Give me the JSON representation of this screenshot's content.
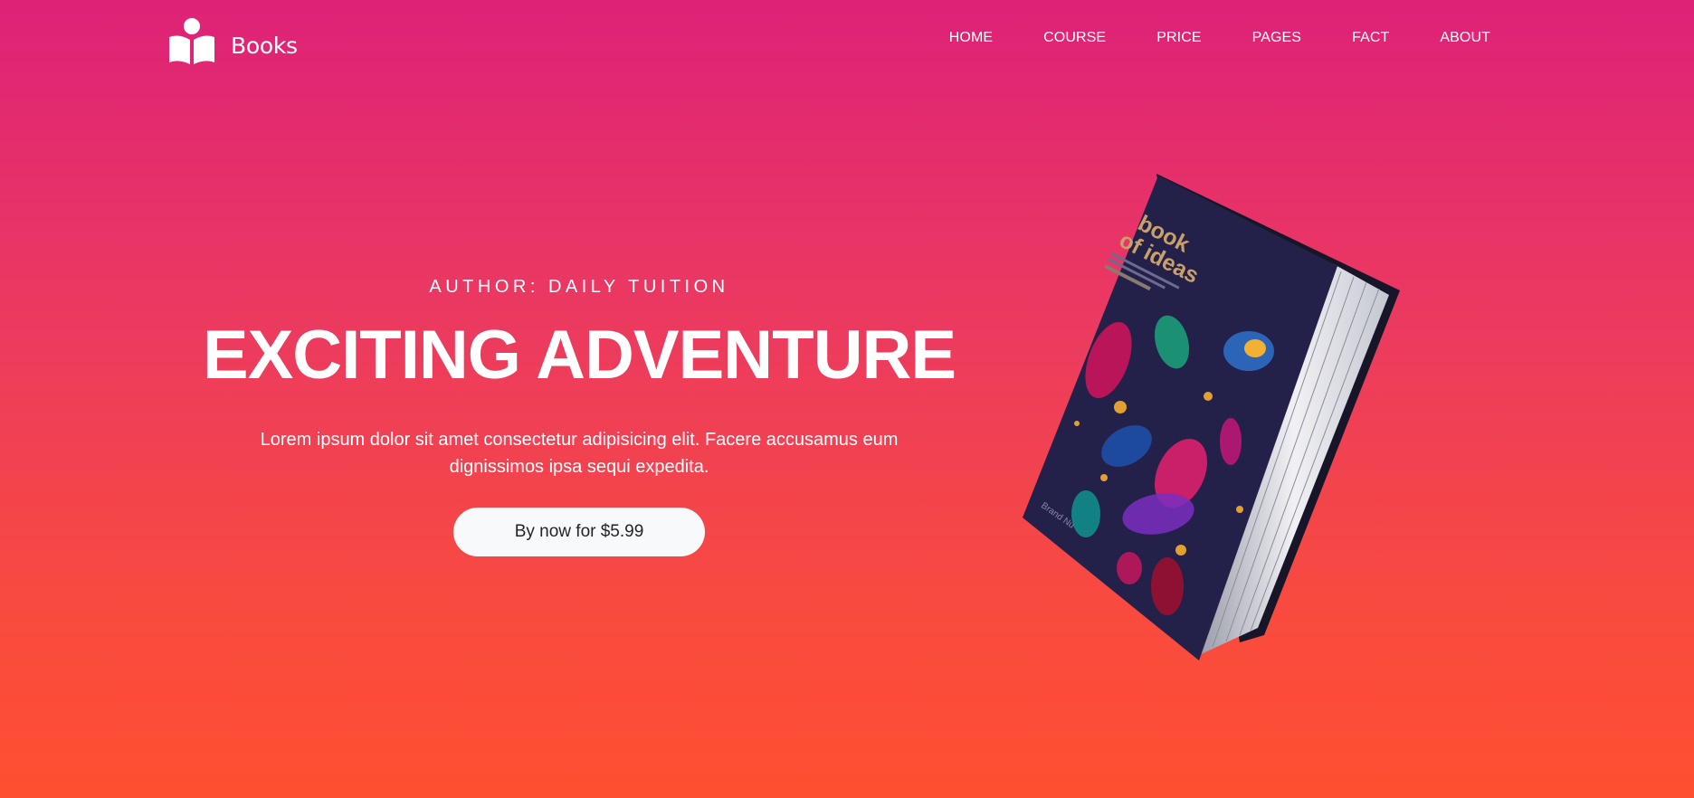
{
  "brand": {
    "name": "Books",
    "logo_icon": "open-book-reader-icon"
  },
  "nav": {
    "items": [
      {
        "label": "HOME"
      },
      {
        "label": "COURSE"
      },
      {
        "label": "PRICE"
      },
      {
        "label": "PAGES"
      },
      {
        "label": "FACT"
      },
      {
        "label": "ABOUT"
      }
    ]
  },
  "hero": {
    "author": "AUTHOR: DAILY TUITION",
    "title": "EXCITING ADVENTURE",
    "lead": "Lorem ipsum dolor sit amet consectetur adipisicing elit. Facere accusamus eum dignissimos ipsa sequi expedita.",
    "cta_label": "By now for $5.99"
  },
  "book": {
    "cover_title_line1": "book",
    "cover_title_line2": "of ideas",
    "cover_brand": "Brand Nu"
  },
  "colors": {
    "gradient_top": "#de2277",
    "gradient_bottom": "#ff4f31",
    "button_bg": "#f8f9fa",
    "book_cover": "#23204a"
  }
}
